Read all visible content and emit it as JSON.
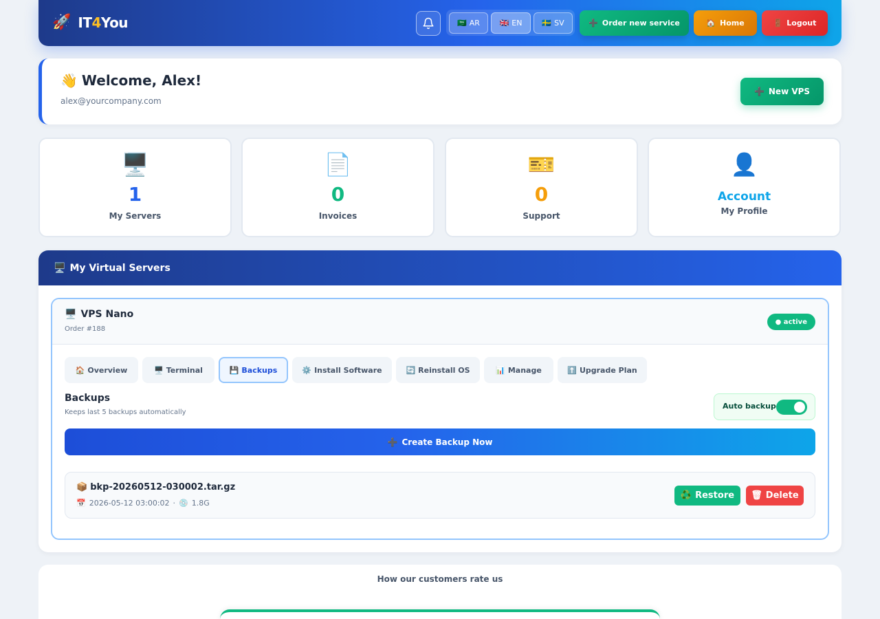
{
  "navbar": {
    "brand_icon": "🚀",
    "brand_prefix": "IT",
    "brand_four": "4",
    "brand_suffix": "You",
    "languages": [
      {
        "flag": "🇸🇦",
        "code": "AR",
        "active": false
      },
      {
        "flag": "🇬🇧",
        "code": "EN",
        "active": true
      },
      {
        "flag": "🇸🇪",
        "code": "SV",
        "active": false
      }
    ],
    "order_icon": "➕",
    "order_label": "Order new service",
    "home_icon": "🏠",
    "home_label": "Home",
    "logout_icon": "🚪",
    "logout_label": "Logout"
  },
  "welcome": {
    "wave": "👋",
    "title": "Welcome, Alex!",
    "email": "alex@yourcompany.com",
    "new_vps_icon": "➕",
    "new_vps_label": "New VPS"
  },
  "stats": [
    {
      "icon": "🖥️",
      "value": "1",
      "label": "My Servers",
      "color": "#2563eb"
    },
    {
      "icon": "📄",
      "value": "0",
      "label": "Invoices",
      "color": "#10b981"
    },
    {
      "icon": "🎫",
      "value": "0",
      "label": "Support",
      "color": "#f59e0b"
    },
    {
      "icon": "👤",
      "value": "Account",
      "label": "My Profile",
      "color": "#0ea5e9"
    }
  ],
  "vps_section": {
    "icon": "🖥️",
    "title": "My Virtual Servers",
    "server": {
      "icon": "🖥️",
      "name": "VPS Nano",
      "order": "Order #188",
      "status": "● active"
    },
    "tabs": [
      {
        "icon": "🏠",
        "label": "Overview"
      },
      {
        "icon": "🖥️",
        "label": "Terminal"
      },
      {
        "icon": "💾",
        "label": "Backups"
      },
      {
        "icon": "⚙️",
        "label": "Install Software"
      },
      {
        "icon": "🔄",
        "label": "Reinstall OS"
      },
      {
        "icon": "📊",
        "label": "Manage"
      },
      {
        "icon": "⬆️",
        "label": "Upgrade Plan"
      }
    ],
    "active_tab": "Backups",
    "backups": {
      "title": "Backups",
      "subtitle": "Keeps last 5 backups automatically",
      "auto_backup_label": "Auto backup",
      "auto_backup_on": true,
      "create_icon": "➕",
      "create_label": "Create Backup Now",
      "items": [
        {
          "icon": "📦",
          "file": "bkp-20260512-030002.tar.gz",
          "date_icon": "📅",
          "date": "2026-05-12 03:00:02",
          "separator": "·",
          "size_icon": "💿",
          "size": "1.8G",
          "restore_icon": "♻️",
          "restore_label": "Restore",
          "delete_icon": "🗑",
          "delete_label": "Delete"
        }
      ]
    }
  },
  "rating": {
    "title": "How our customers rate us"
  },
  "colors": {
    "primary": "#2563eb",
    "success": "#10b981",
    "warning": "#f59e0b",
    "danger": "#ef4444",
    "background": "#eef2f7"
  }
}
